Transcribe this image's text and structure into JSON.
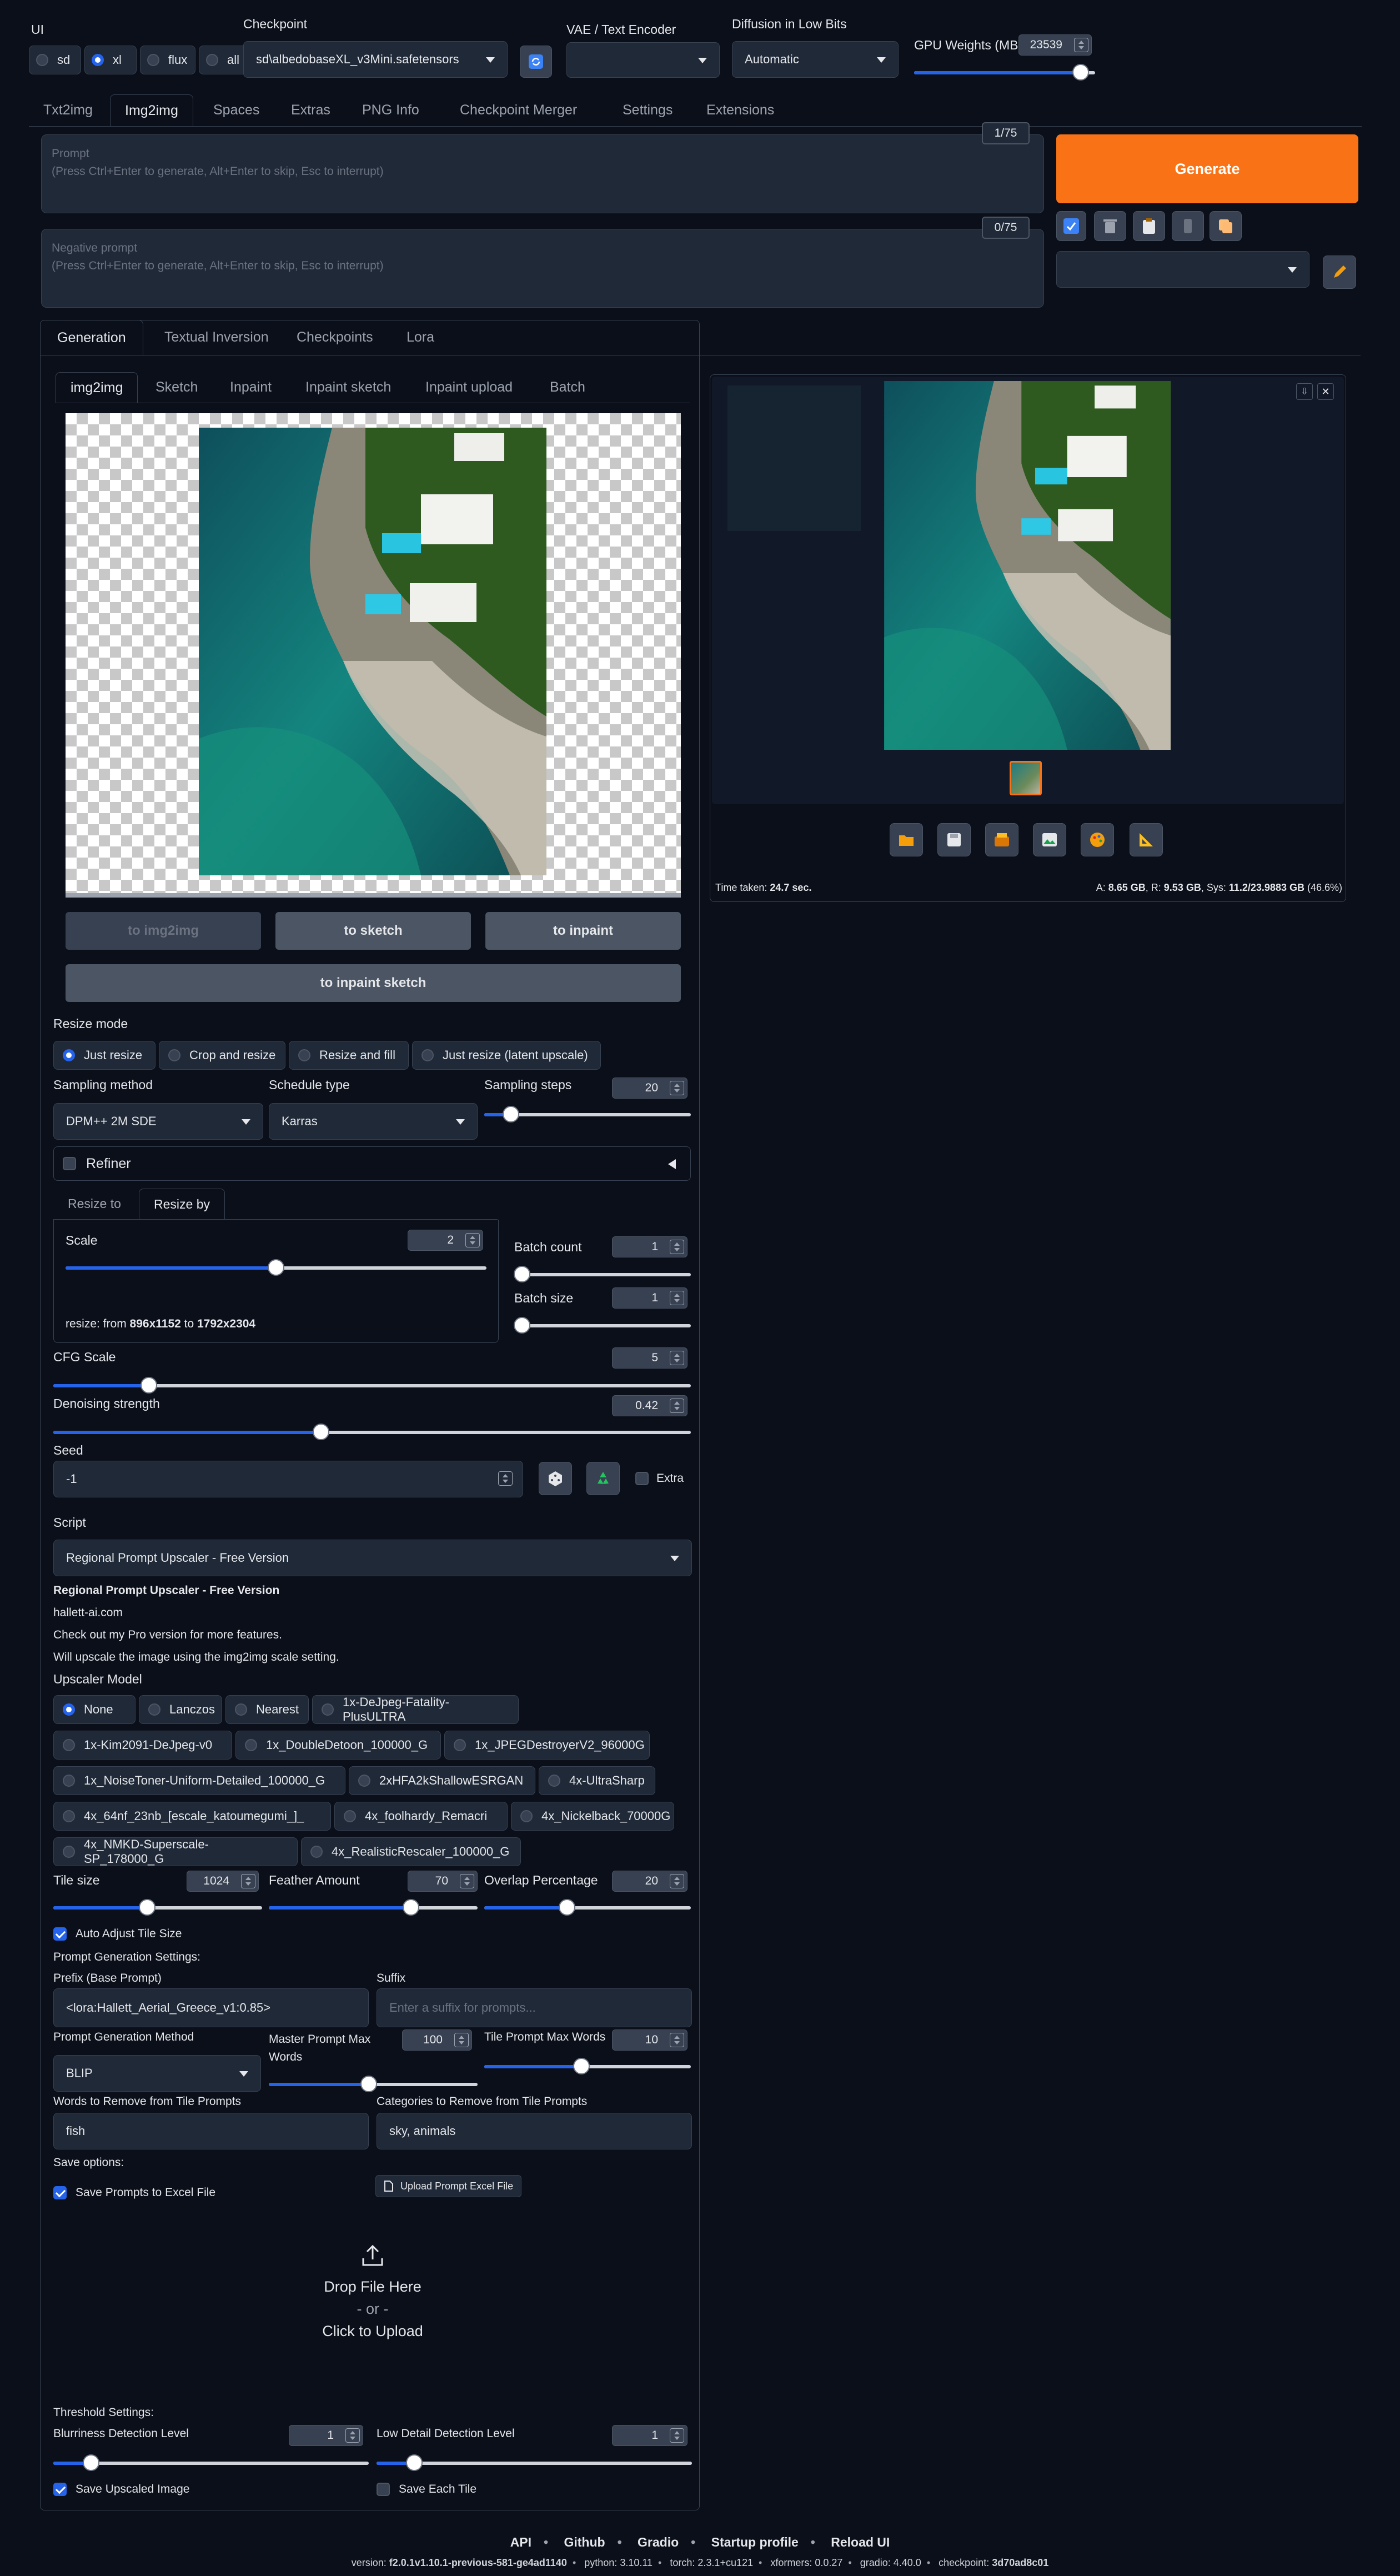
{
  "top": {
    "ui_label": "UI",
    "ui_options": [
      "sd",
      "xl",
      "flux",
      "all"
    ],
    "checkpoint_label": "Checkpoint",
    "checkpoint_value": "sd\\albedobaseXL_v3Mini.safetensors",
    "vae_label": "VAE / Text Encoder",
    "diffusion_label": "Diffusion in Low Bits",
    "diffusion_value": "Automatic",
    "gpu_label": "GPU Weights (MB)",
    "gpu_value": "23539",
    "gpu_fraction": 0.92
  },
  "main_tabs": [
    "Txt2img",
    "Img2img",
    "Spaces",
    "Extras",
    "PNG Info",
    "Checkpoint Merger",
    "Settings",
    "Extensions"
  ],
  "prompt": {
    "label": "Prompt",
    "placeholder": "(Press Ctrl+Enter to generate, Alt+Enter to skip, Esc to interrupt)",
    "counter": "1/75"
  },
  "negative": {
    "label": "Negative prompt",
    "placeholder": "(Press Ctrl+Enter to generate, Alt+Enter to skip, Esc to interrupt)",
    "counter": "0/75"
  },
  "generate_label": "Generate",
  "sub_tabs": [
    "Generation",
    "Textual Inversion",
    "Checkpoints",
    "Lora"
  ],
  "img_tabs": [
    "img2img",
    "Sketch",
    "Inpaint",
    "Inpaint sketch",
    "Inpaint upload",
    "Batch"
  ],
  "send_buttons": {
    "to_img2img": "to img2img",
    "to_sketch": "to sketch",
    "to_inpaint": "to inpaint",
    "to_inpaint_sketch": "to inpaint sketch"
  },
  "resize_mode": {
    "label": "Resize mode",
    "options": [
      "Just resize",
      "Crop and resize",
      "Resize and fill",
      "Just resize (latent upscale)"
    ]
  },
  "sampling": {
    "method_label": "Sampling method",
    "method_value": "DPM++ 2M SDE",
    "schedule_label": "Schedule type",
    "schedule_value": "Karras",
    "steps_label": "Sampling steps",
    "steps_value": "20",
    "steps_fraction": 0.13
  },
  "refiner_label": "Refiner",
  "resize_tabs": [
    "Resize to",
    "Resize by"
  ],
  "scale": {
    "label": "Scale",
    "value": "2",
    "fraction": 0.5,
    "resize_prefix": "resize: from ",
    "from": "896x1152",
    "to_word": " to ",
    "to": "1792x2304"
  },
  "batch": {
    "count_label": "Batch count",
    "count_value": "1",
    "count_fraction": 0.0,
    "size_label": "Batch size",
    "size_value": "1",
    "size_fraction": 0.0
  },
  "cfg": {
    "label": "CFG Scale",
    "value": "5",
    "fraction": 0.15
  },
  "denoise": {
    "label": "Denoising strength",
    "value": "0.42",
    "fraction": 0.42
  },
  "seed": {
    "label": "Seed",
    "value": "-1",
    "extra_label": "Extra"
  },
  "script": {
    "label": "Script",
    "value": "Regional Prompt Upscaler - Free Version"
  },
  "rpu": {
    "title": "Regional Prompt Upscaler - Free Version",
    "site": "hallett-ai.com",
    "pro": "Check out my Pro version for more features.",
    "note": "Will upscale the image using the img2img scale setting.",
    "model_label": "Upscaler Model",
    "models": [
      [
        "None",
        "Lanczos",
        "Nearest",
        "1x-DeJpeg-Fatality-PlusULTRA"
      ],
      [
        "1x-Kim2091-DeJpeg-v0",
        "1x_DoubleDetoon_100000_G",
        "1x_JPEGDestroyerV2_96000G"
      ],
      [
        "1x_NoiseToner-Uniform-Detailed_100000_G",
        "2xHFA2kShallowESRGAN",
        "4x-UltraSharp"
      ],
      [
        "4x_64nf_23nb_[escale_katoumegumi_]_",
        "4x_foolhardy_Remacri",
        "4x_Nickelback_70000G"
      ],
      [
        "4x_NMKD-Superscale-SP_178000_G",
        "4x_RealisticRescaler_100000_G"
      ]
    ],
    "tile_label": "Tile size",
    "tile_value": "1024",
    "tile_fraction": 0.45,
    "feather_label": "Feather Amount",
    "feather_value": "70",
    "feather_fraction": 0.68,
    "overlap_label": "Overlap Percentage",
    "overlap_value": "20",
    "overlap_fraction": 0.4,
    "auto_adjust": "Auto Adjust Tile Size",
    "prompt_gen": "Prompt Generation Settings:",
    "prefix_label": "Prefix (Base Prompt)",
    "prefix_value": "<lora:Hallett_Aerial_Greece_v1:0.85>",
    "suffix_label": "Suffix",
    "suffix_placeholder": "Enter a suffix for prompts...",
    "method_label": "Prompt Generation Method",
    "method_value": "BLIP",
    "master_label": "Master Prompt Max Words",
    "master_value": "100",
    "master_fraction": 0.48,
    "tile_words_label": "Tile Prompt Max Words",
    "tile_words_value": "10",
    "tile_words_fraction": 0.47,
    "remove_label": "Words to Remove from Tile Prompts",
    "remove_value": "fish",
    "categories_label": "Categories to Remove from Tile Prompts",
    "categories_value": "sky, animals",
    "save_options": "Save options:",
    "save_excel": "Save Prompts to Excel File",
    "upload_excel": "Upload Prompt Excel File",
    "drop_here": "Drop File Here",
    "or": "- or -",
    "click_upload": "Click to Upload",
    "threshold": "Threshold Settings:",
    "blur_label": "Blurriness Detection Level",
    "blur_value": "1",
    "blur_fraction": 0.12,
    "lowdetail_label": "Low Detail Detection Level",
    "lowdetail_value": "1",
    "lowdetail_fraction": 0.12,
    "save_upscaled": "Save Upscaled Image",
    "save_each": "Save Each Tile"
  },
  "output": {
    "time_label": "Time taken: ",
    "time_value": "24.7 sec.",
    "mem_a_label": "A: ",
    "mem_a": "8.65 GB",
    "mem_r_label": ", R: ",
    "mem_r": "9.53 GB",
    "mem_sys_label": ", Sys: ",
    "mem_sys": "11.2/23.9883 GB",
    "mem_pct": " (46.6%)"
  },
  "footer": {
    "links": [
      "API",
      "Github",
      "Gradio",
      "Startup profile",
      "Reload UI"
    ],
    "version_label": "version: ",
    "version": "f2.0.1v1.10.1-previous-581-ge4ad1140",
    "python_label": "python: ",
    "python": "3.10.11",
    "torch_label": "torch: ",
    "torch": "2.3.1+cu121",
    "xformers_label": "xformers: ",
    "xformers": "0.0.27",
    "gradio_label": "gradio: ",
    "gradio": "4.40.0",
    "checkpoint_label": "checkpoint: ",
    "checkpoint": "3d70ad8c01"
  },
  "colors": {
    "bg": "#0b0f19",
    "panel": "#1f2937",
    "accent": "#2563eb",
    "generate": "#f97316"
  }
}
